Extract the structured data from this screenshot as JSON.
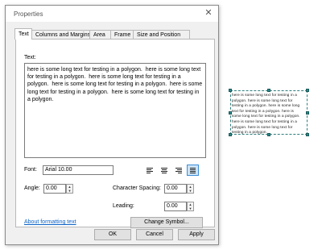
{
  "dialog": {
    "title": "Properties",
    "close_glyph": "✕",
    "tabs": [
      {
        "label": "Text"
      },
      {
        "label": "Columns and Margins"
      },
      {
        "label": "Area"
      },
      {
        "label": "Frame"
      },
      {
        "label": "Size and Position"
      }
    ],
    "active_tab": "Text",
    "text_label": "Text:",
    "text_value": "here is some long text for testing in a polygon.  here is some long text for testing in a polygon.  here is some long text for testing in a polygon.  here is some long text for testing in a polygon.  here is some long text for testing in a polygon.  here is some long text for testing in a polygon.",
    "font_label": "Font:",
    "font_value": "Arial 10.00",
    "alignment": {
      "options": [
        "align-left",
        "align-center",
        "align-right",
        "justify"
      ],
      "selected": "justify"
    },
    "angle_label": "Angle:",
    "angle_value": "0.00",
    "char_spacing_label": "Character Spacing:",
    "char_spacing_value": "0.00",
    "leading_label": "Leading:",
    "leading_value": "0.00",
    "formatting_link": "About formatting text",
    "change_symbol_label": "Change Symbol...",
    "ok_label": "OK",
    "cancel_label": "Cancel",
    "apply_label": "Apply"
  },
  "preview": {
    "lines": [
      "here is some long text for testing in a",
      "polygon.  here is some long text for",
      "testing in a polygon.  here is some long",
      "text for testing in a polygon.  here is",
      "some long text for testing in a polygon.",
      "here is some long text for testing in a",
      "polygon.  here is some long text for",
      "testing in a polygon."
    ],
    "frame_color": "#2f7d7d"
  }
}
